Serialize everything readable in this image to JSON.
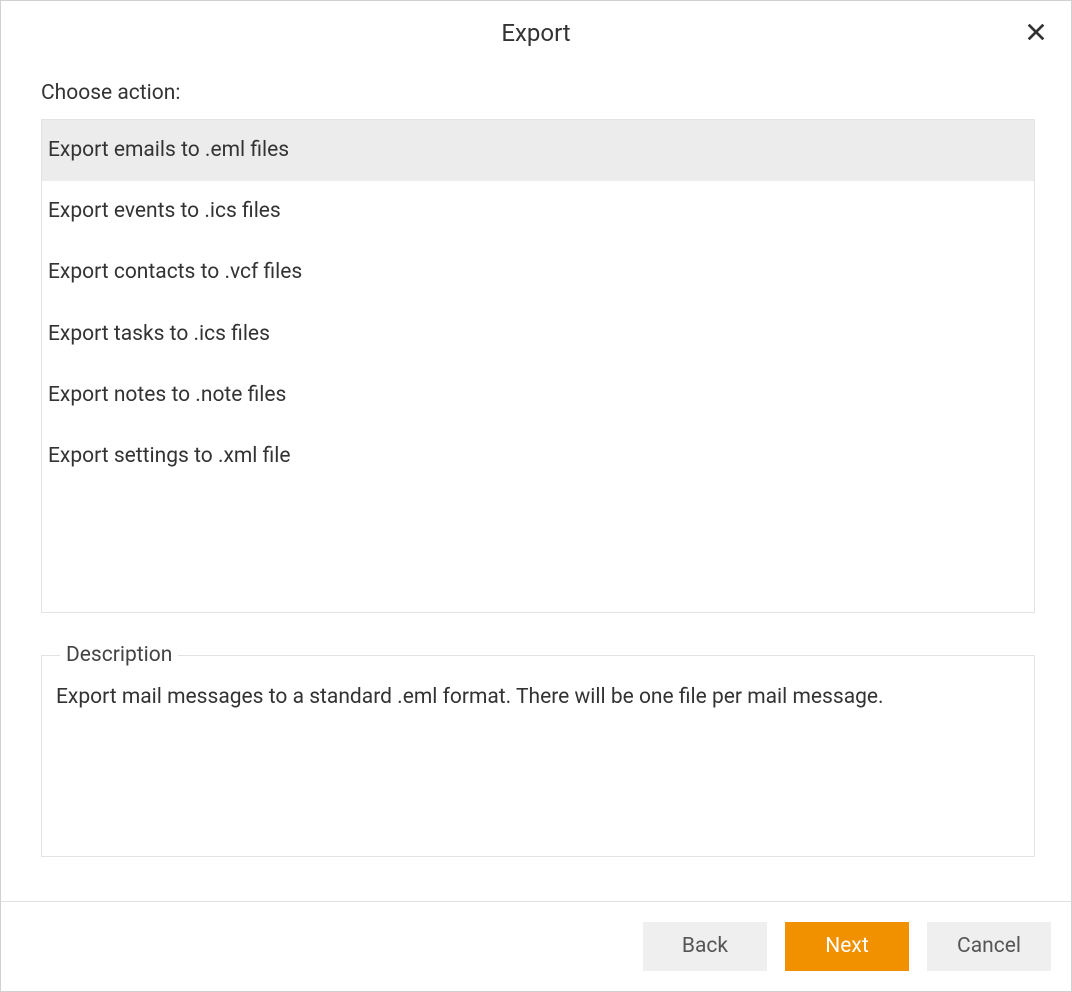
{
  "dialog": {
    "title": "Export",
    "choose_label": "Choose action:",
    "actions": [
      {
        "label": "Export emails to .eml files",
        "selected": true
      },
      {
        "label": "Export events to .ics files",
        "selected": false
      },
      {
        "label": "Export contacts to .vcf files",
        "selected": false
      },
      {
        "label": "Export tasks to .ics files",
        "selected": false
      },
      {
        "label": "Export notes to .note files",
        "selected": false
      },
      {
        "label": "Export settings to .xml file",
        "selected": false
      }
    ],
    "description_label": "Description",
    "description_text": "Export mail messages to a standard .eml format. There will be one file per mail message."
  },
  "footer": {
    "back_label": "Back",
    "next_label": "Next",
    "cancel_label": "Cancel"
  }
}
